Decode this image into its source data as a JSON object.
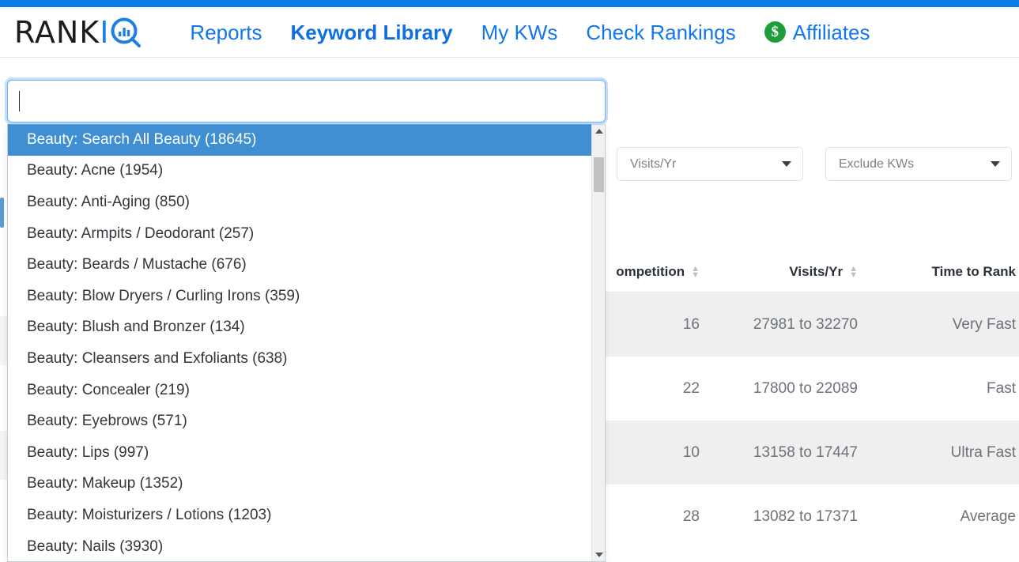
{
  "brand": {
    "logo_rank": "RANK",
    "logo_iq": "IQ",
    "accent_blue": "#1277e8",
    "top_strip_color": "#0b7ce8",
    "affiliate_badge_color": "#1e9e3b",
    "dollar_glyph": "$"
  },
  "nav": {
    "items": [
      {
        "label": "Reports",
        "active": false
      },
      {
        "label": "Keyword Library",
        "active": true
      },
      {
        "label": "My KWs",
        "active": false
      },
      {
        "label": "Check Rankings",
        "active": false
      },
      {
        "label": "Affiliates",
        "active": false,
        "icon": "dollar-circle-icon"
      }
    ]
  },
  "search": {
    "value": "",
    "placeholder": ""
  },
  "dropdown": {
    "selected_index": 0,
    "items": [
      "Beauty: Search All Beauty (18645)",
      "Beauty: Acne (1954)",
      "Beauty: Anti-Aging (850)",
      "Beauty: Armpits / Deodorant (257)",
      "Beauty: Beards / Mustache (676)",
      "Beauty: Blow Dryers / Curling Irons (359)",
      "Beauty: Blush and Bronzer (134)",
      "Beauty: Cleansers and Exfoliants (638)",
      "Beauty: Concealer (219)",
      "Beauty: Eyebrows (571)",
      "Beauty: Lips (997)",
      "Beauty: Makeup (1352)",
      "Beauty: Moisturizers / Lotions (1203)",
      "Beauty: Nails (3930)"
    ],
    "scrollbar": {
      "up_arrow": "scroll-up-arrow-icon",
      "down_arrow": "scroll-down-arrow-icon"
    }
  },
  "filters": [
    {
      "label": "Visits/Yr",
      "icon": "chevron-down-icon"
    },
    {
      "label": "Exclude KWs",
      "icon": "chevron-down-icon"
    },
    {
      "label": "",
      "icon": "chevron-down-icon"
    }
  ],
  "table": {
    "columns": [
      {
        "label": "ompetition",
        "sortable": true
      },
      {
        "label": "Visits/Yr",
        "sortable": true
      },
      {
        "label": "Time to Rank",
        "sortable": false
      }
    ],
    "rows": [
      {
        "competition": "16",
        "visits": "27981 to 32270",
        "time_to_rank": "Very Fast"
      },
      {
        "competition": "22",
        "visits": "17800 to 22089",
        "time_to_rank": "Fast"
      },
      {
        "competition": "10",
        "visits": "13158 to 17447",
        "time_to_rank": "Ultra Fast"
      },
      {
        "competition": "28",
        "visits": "13082 to 17371",
        "time_to_rank": "Average"
      }
    ]
  }
}
